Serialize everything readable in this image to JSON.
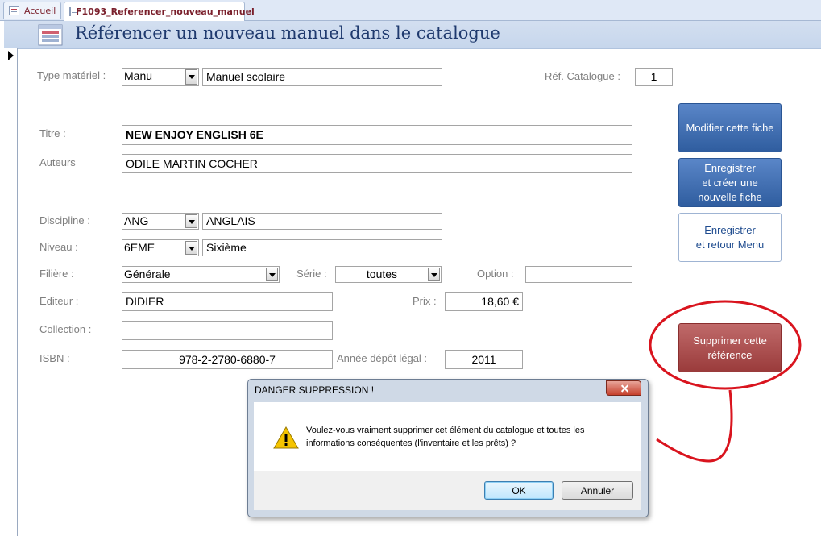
{
  "tabs": [
    {
      "label": "Accueil"
    },
    {
      "label": "F1093_Referencer_nouveau_manuel"
    }
  ],
  "header": {
    "title": "Référencer un nouveau manuel dans le catalogue"
  },
  "form": {
    "type_materiel": {
      "label": "Type matériel :",
      "code": "Manu",
      "value": "Manuel scolaire"
    },
    "ref_catalogue": {
      "label": "Réf. Catalogue :",
      "value": "1"
    },
    "titre": {
      "label": "Titre :",
      "value": "NEW ENJOY ENGLISH 6E"
    },
    "auteurs": {
      "label": "Auteurs",
      "value": "ODILE MARTIN COCHER"
    },
    "discipline": {
      "label": "Discipline :",
      "code": "ANG",
      "value": "ANGLAIS"
    },
    "niveau": {
      "label": "Niveau :",
      "code": "6EME",
      "value": "Sixième"
    },
    "filiere": {
      "label": "Filière :",
      "value": "Générale"
    },
    "serie": {
      "label": "Série :",
      "value": "toutes"
    },
    "option": {
      "label": "Option :",
      "value": ""
    },
    "editeur": {
      "label": "Editeur :",
      "value": "DIDIER"
    },
    "prix": {
      "label": "Prix :",
      "value": "18,60 €"
    },
    "collection": {
      "label": "Collection :",
      "value": ""
    },
    "isbn": {
      "label": "ISBN :",
      "value": "978-2-2780-6880-7"
    },
    "annee": {
      "label": "Année dépôt légal :",
      "value": "2011"
    }
  },
  "buttons": {
    "modifier": "Modifier cette fiche",
    "enregistrer_nouvelle": "Enregistrer\net créer une\nnouvelle fiche",
    "enregistrer_retour": "Enregistrer\net retour Menu",
    "supprimer": "Supprimer cette\nréférence"
  },
  "dialog": {
    "title": "DANGER SUPPRESSION !",
    "message": "Voulez-vous vraiment supprimer cet élément du catalogue et toutes les informations conséquentes (l'inventaire et les prêts) ?",
    "ok": "OK",
    "cancel": "Annuler"
  },
  "icons": {
    "warning": "warning-icon",
    "close": "close-icon",
    "form": "form-icon",
    "record": "record-selector-arrow-icon"
  },
  "colors": {
    "accent_blue": "#2f5d9f",
    "danger_red": "#9a3b3b",
    "annotation_red": "#d9141e"
  }
}
